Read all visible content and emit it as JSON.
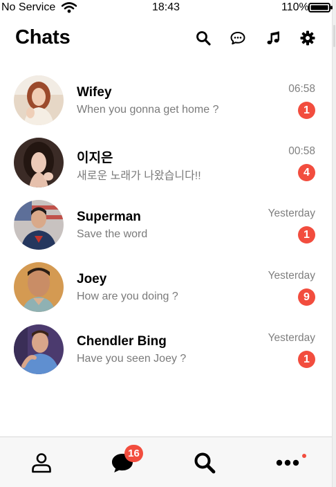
{
  "status_bar": {
    "carrier": "No Service",
    "time": "18:43",
    "battery": "110%"
  },
  "header": {
    "title": "Chats",
    "actions": [
      "search-icon",
      "chat-bubble-icon",
      "music-note-icon",
      "gear-icon"
    ]
  },
  "chats": [
    {
      "name": "Wifey",
      "preview": "When you gonna get home ?",
      "time": "06:58",
      "unread": "1"
    },
    {
      "name": "이지은",
      "preview": "새로운 노래가 나왔습니다!!",
      "time": "00:58",
      "unread": "4"
    },
    {
      "name": "Superman",
      "preview": "Save the word",
      "time": "Yesterday",
      "unread": "1"
    },
    {
      "name": "Joey",
      "preview": "How are you doing ?",
      "time": "Yesterday",
      "unread": "9"
    },
    {
      "name": "Chendler Bing",
      "preview": "Have you seen Joey ?",
      "time": "Yesterday",
      "unread": "1"
    }
  ],
  "tab_bar": {
    "tabs": [
      "person-icon",
      "chat-bubble-icon",
      "search-icon",
      "more-icon"
    ],
    "chats_badge": "16"
  },
  "colors": {
    "badge": "#f24d3e",
    "secondary_text": "#7a7a7a",
    "tab_bar_bg": "#f7f7f7"
  }
}
